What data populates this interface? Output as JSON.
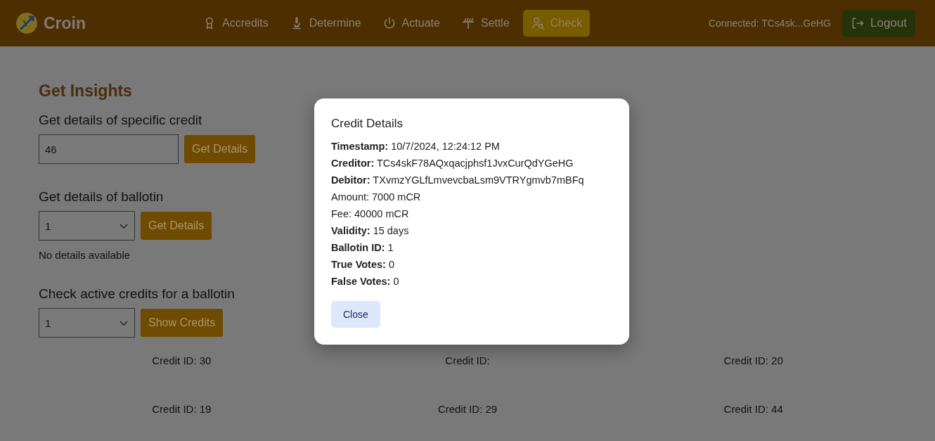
{
  "header": {
    "brand": "Croin",
    "nav": [
      {
        "label": "Accredits",
        "kind": "award",
        "selected": false
      },
      {
        "label": "Determine",
        "kind": "microscope",
        "selected": false
      },
      {
        "label": "Actuate",
        "kind": "power",
        "selected": false
      },
      {
        "label": "Settle",
        "kind": "antenna",
        "selected": false
      },
      {
        "label": "Check",
        "kind": "user-search",
        "selected": true
      }
    ],
    "connected": "Connected: TCs4sk...GeHG",
    "logout": "Logout"
  },
  "page": {
    "title": "Get Insights",
    "credit_section": {
      "heading": "Get details of specific credit",
      "value": "46",
      "button": "Get Details"
    },
    "ballotin_section": {
      "heading": "Get details of ballotin",
      "value": "1",
      "button": "Get Details",
      "message": "No details available"
    },
    "active_section": {
      "heading": "Check active credits for a ballotin",
      "value": "1",
      "button": "Show Credits"
    },
    "credits": [
      "Credit ID: 30",
      "Credit ID:",
      "Credit ID: 20",
      "Credit ID: 19",
      "Credit ID: 29",
      "Credit ID: 44"
    ]
  },
  "modal": {
    "title": "Credit Details",
    "lines": [
      "**Timestamp:** 10/7/2024, 12:24:12 PM",
      "**Creditor:** TCs4skF78AQxqacjphsf1JvxCurQdYGeHG",
      "**Debitor:** TXvmzYGLfLmvevcbaLsm9VTRYgmvb7mBFq",
      "Amount: 7000 mCR",
      "Fee: 40000 mCR",
      "**Validity:** 15 days",
      "**Ballotin ID:** 1",
      "**True Votes:** 0",
      "**False Votes:** 0"
    ],
    "close": "Close"
  }
}
